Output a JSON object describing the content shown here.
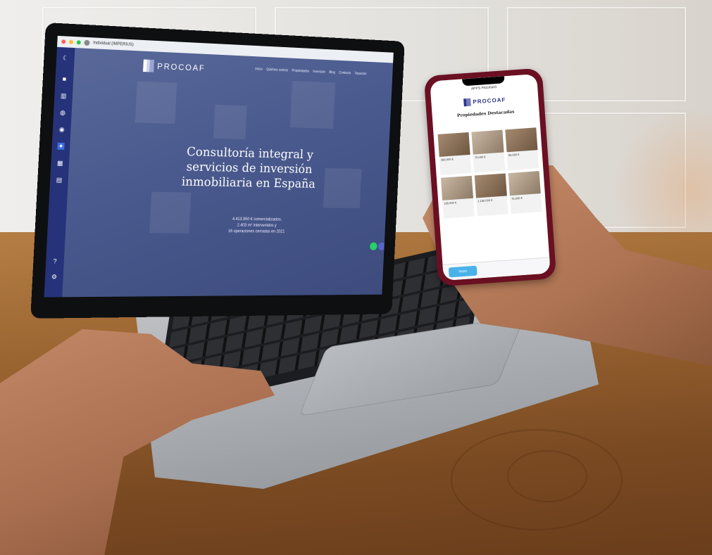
{
  "laptop": {
    "browser": {
      "account_label": "Individual (IMPERIUS)"
    },
    "site": {
      "logo_text": "PROCOAF",
      "nav": [
        "Inicio",
        "Quiénes somos",
        "Propiedades",
        "Inversión",
        "Blog",
        "Contacto",
        "Tasación"
      ],
      "hero_line1": "Consultoría integral y",
      "hero_line2": "servicios de inversión",
      "hero_line3": "inmobiliaria en España",
      "sub_line1": "4.413.950 € comercializados,",
      "sub_line2": "2.403 m² intervenidos y",
      "sub_line3": "16 operaciones cerradas en 2021"
    }
  },
  "phone": {
    "header": "APPS PAGINAS",
    "logo_text": "PROCOAF",
    "section_title": "Propiedades Destacadas",
    "tab_button": "Inicio",
    "cards": [
      {
        "price": "280.000 €"
      },
      {
        "price": "75.000 €"
      },
      {
        "price": "95.000 €"
      },
      {
        "price": "165.000 €"
      },
      {
        "price": "1.150.000 €"
      },
      {
        "price": "75.000 €"
      }
    ]
  },
  "colors": {
    "brand_navy": "#26337a",
    "whatsapp": "#25d366",
    "phone_case": "#6a1022"
  }
}
